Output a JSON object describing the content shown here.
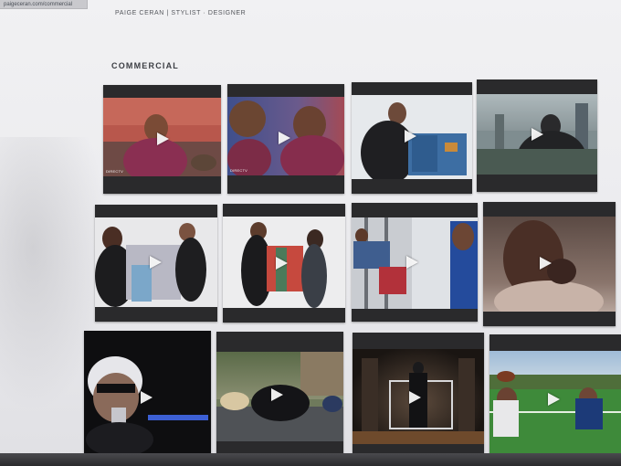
{
  "browser": {
    "url_text": "paigeceran.com/commercial"
  },
  "header": {
    "site_title": "PAIGE CERAN | STYLIST · DESIGNER"
  },
  "section": {
    "title": "COMMERCIAL"
  },
  "videos": [
    {
      "brand": "DIRECTV",
      "icon": "play-icon"
    },
    {
      "brand": "DIRECTV",
      "icon": "play-icon"
    },
    {
      "brand": "",
      "icon": "play-icon"
    },
    {
      "brand": "",
      "icon": "play-icon"
    },
    {
      "brand": "",
      "icon": "play-icon"
    },
    {
      "brand": "",
      "icon": "play-icon"
    },
    {
      "brand": "",
      "icon": "play-icon"
    },
    {
      "brand": "",
      "icon": "play-icon"
    },
    {
      "brand": "",
      "icon": "play-icon"
    },
    {
      "brand": "",
      "icon": "play-icon"
    },
    {
      "brand": "",
      "icon": "play-icon"
    },
    {
      "brand": "",
      "icon": "play-icon"
    }
  ],
  "colors": {
    "page_background": "#ececef",
    "tile_frame": "#1a1a1c",
    "heading_text": "#3c3e44",
    "play_icon": "#ffffff"
  }
}
